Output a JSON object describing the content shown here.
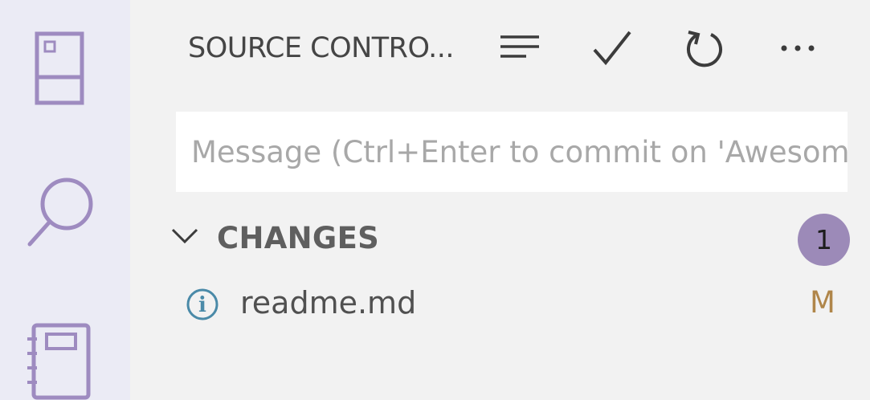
{
  "panel": {
    "title": "SOURCE CONTRO...",
    "toolbar": {
      "view_icon": "list-icon",
      "commit_icon": "checkmark-icon",
      "refresh_icon": "refresh-icon",
      "more_icon": "ellipsis-icon"
    },
    "commit_message": {
      "value": "",
      "placeholder": "Message (Ctrl+Enter to commit on 'Awesome')"
    },
    "changes": {
      "label": "CHANGES",
      "count": "1",
      "files": [
        {
          "name": "readme.md",
          "status": "M",
          "icon": "info-icon"
        }
      ]
    }
  },
  "activity_bar": {
    "items": [
      {
        "icon": "explorer-icon"
      },
      {
        "icon": "search-icon"
      },
      {
        "icon": "notebook-icon"
      }
    ]
  },
  "colors": {
    "activity_bar_bg": "#ebebf5",
    "activity_icon": "#9e8bc0",
    "panel_bg": "#f2f2f2",
    "badge_bg": "#9c8ab8",
    "modified_status": "#b0864a",
    "info_icon": "#4a8aa8"
  }
}
